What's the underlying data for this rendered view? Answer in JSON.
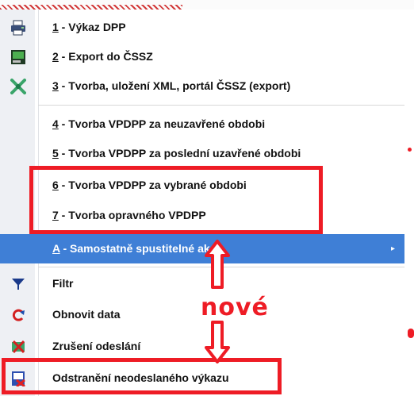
{
  "menu": {
    "items": [
      {
        "key": "1",
        "rest": " - Výkaz DPP",
        "icon": "printer-icon"
      },
      {
        "key": "2",
        "rest": " - Export do ČSSZ",
        "icon": "terminal-icon"
      },
      {
        "key": "3",
        "rest": " - Tvorba, uložení XML, portál ČSSZ (export)",
        "icon": "xml-icon"
      },
      {
        "key": "4",
        "rest": " - Tvorba VPDPP za neuzavřené obdobi"
      },
      {
        "key": "5",
        "rest": " - Tvorba VPDPP za poslední uzavřené obdobi"
      },
      {
        "key": "6",
        "rest": " - Tvorba VPDPP za vybrané obdobi"
      },
      {
        "key": "7",
        "rest": " - Tvorba opravného VPDPP"
      },
      {
        "key": "A",
        "rest": " - Samostatně spustitelné akce",
        "submenu": "▸"
      },
      {
        "key": "",
        "rest": "Filtr",
        "icon": "filter-icon"
      },
      {
        "key": "",
        "rest": "Obnovit data",
        "icon": "refresh-icon"
      },
      {
        "key": "",
        "rest": "Zrušení odeslání",
        "icon": "cancel-send-icon"
      },
      {
        "key": "",
        "rest": "Odstranění neodeslaného výkazu",
        "icon": "delete-report-icon"
      }
    ]
  },
  "annotation": {
    "text": "nové"
  },
  "colors": {
    "highlight": "#3f7fd6",
    "annotation": "#ee1c25",
    "gutter": "#eef0f4"
  }
}
